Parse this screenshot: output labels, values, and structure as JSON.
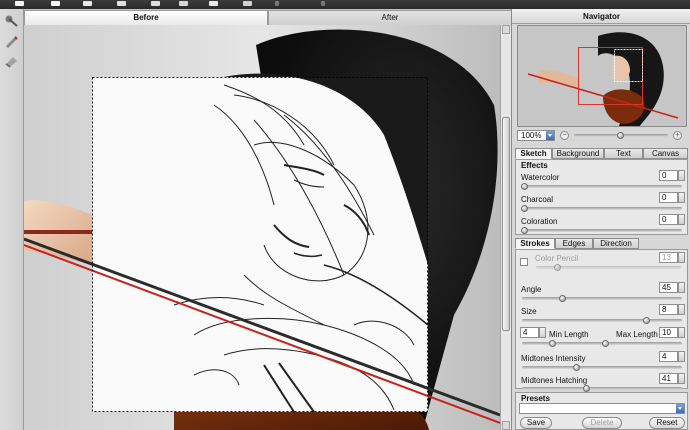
{
  "view_tabs": {
    "before": "Before",
    "after": "After"
  },
  "navigator": {
    "title": "Navigator",
    "zoom": "100%"
  },
  "panel_tabs": [
    "Sketch",
    "Background",
    "Text",
    "Canvas"
  ],
  "effects": {
    "title": "Effects",
    "watercolor": {
      "label": "Watercolor",
      "value": "0"
    },
    "charcoal": {
      "label": "Charcoal",
      "value": "0"
    },
    "coloration": {
      "label": "Coloration",
      "value": "0"
    }
  },
  "stroke_tabs": [
    "Strokes",
    "Edges",
    "Direction"
  ],
  "strokes": {
    "color_pencil": {
      "label": "Color Pencil",
      "value": "13",
      "checked": false
    },
    "angle": {
      "label": "Angle",
      "value": "45"
    },
    "size": {
      "label": "Size",
      "value": "8"
    },
    "min_length": {
      "label": "Min Length",
      "value": "4"
    },
    "max_length": {
      "label": "Max Length",
      "value": "10"
    },
    "midtones_intensity": {
      "label": "Midtones Intensity",
      "value": "4"
    },
    "midtones_hatching": {
      "label": "Midtones Hatching",
      "value": "41"
    }
  },
  "presets": {
    "title": "Presets",
    "save": "Save",
    "delete": "Delete",
    "reset": "Reset"
  },
  "colors": {
    "accent_blue": "#3b6bb0",
    "nav_frame": "#d9342b",
    "bow_red": "#c5231c"
  }
}
